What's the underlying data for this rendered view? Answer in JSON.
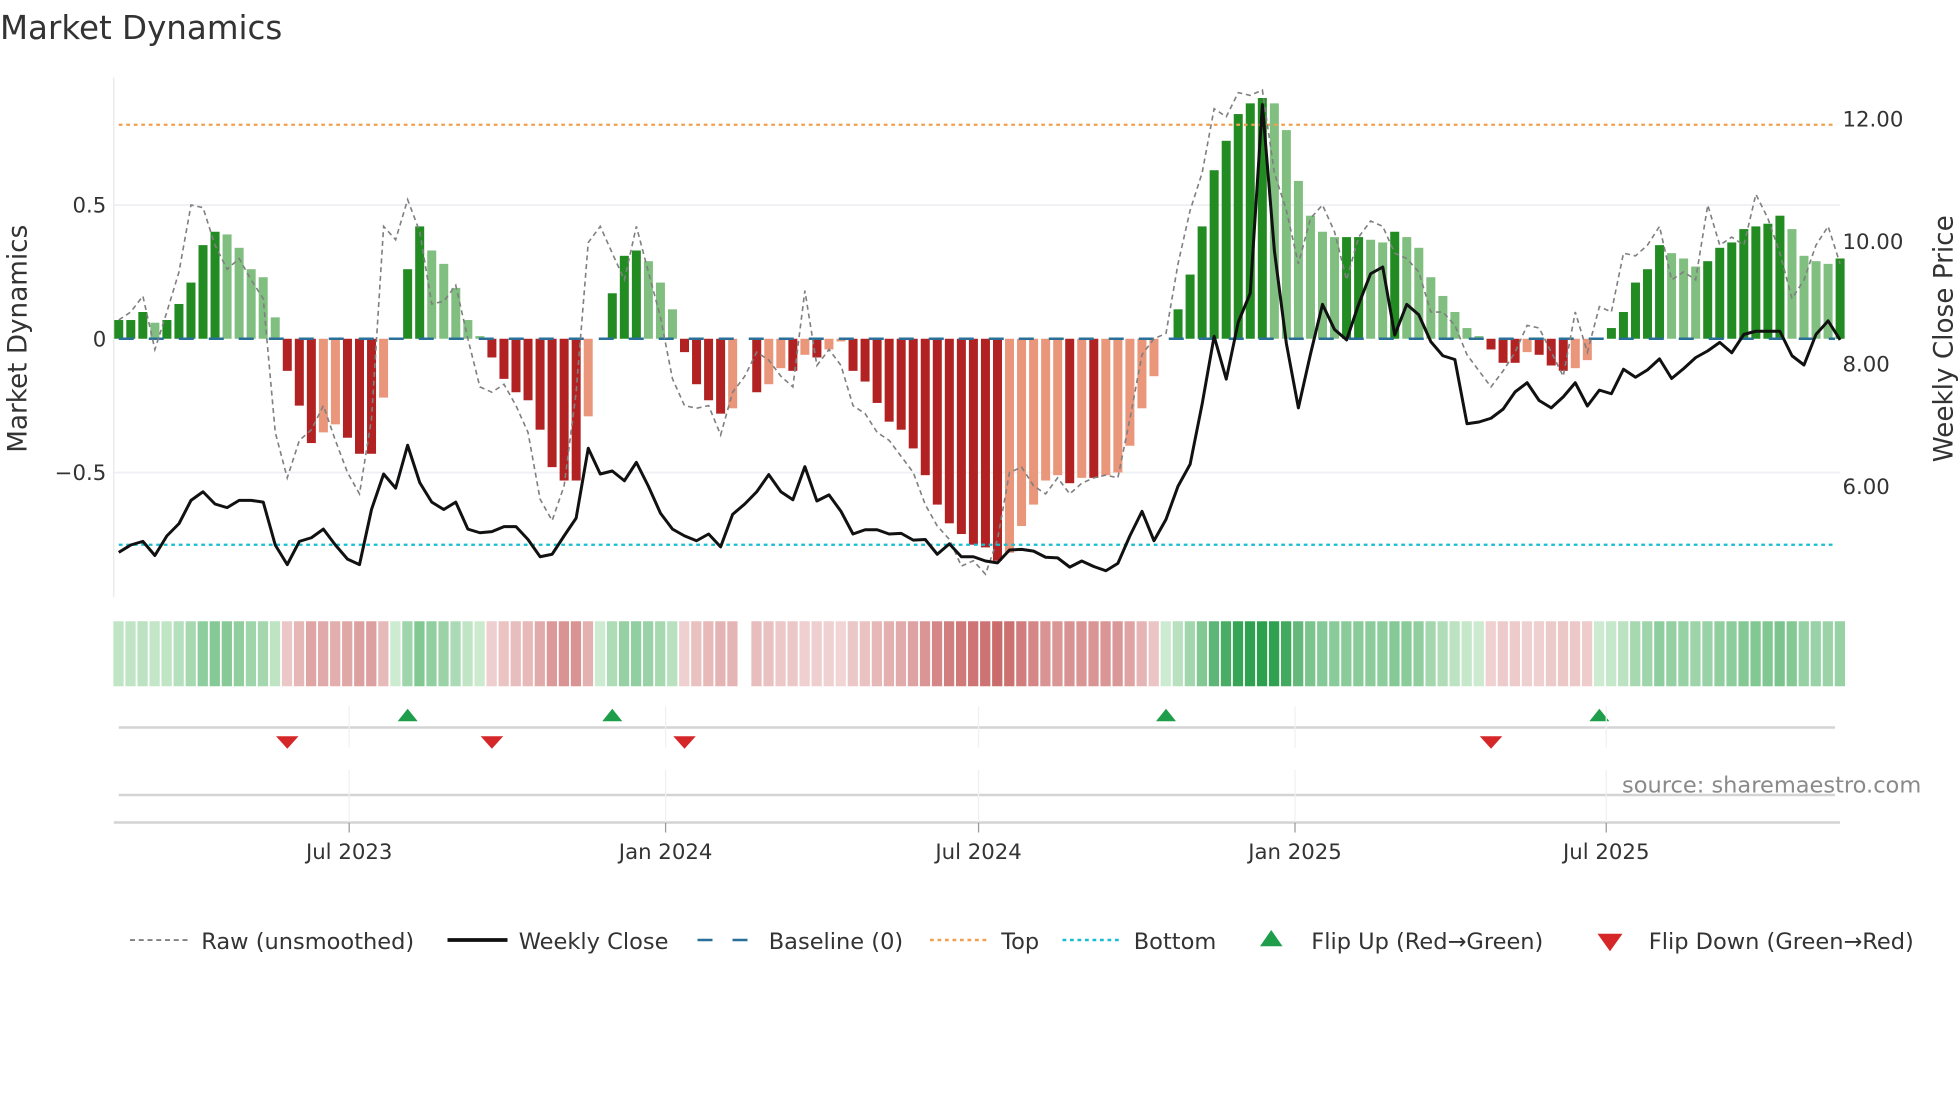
{
  "title": "Market Dynamics",
  "source": "source: sharemaestro.com",
  "chart_data": {
    "type": "bar",
    "title": "Market Dynamics",
    "ylabel": "Market Dynamics",
    "y2label": "Weekly Close Price",
    "ylim": [
      -1.0,
      0.97
    ],
    "y2lim": [
      3.85,
      13.3
    ],
    "start_date": "2023-02-17",
    "step_days": 7,
    "yticks": [
      {
        "v": 0.5,
        "label": "0.5"
      },
      {
        "v": 0,
        "label": "0"
      },
      {
        "v": -0.5,
        "label": "−0.5"
      }
    ],
    "y2ticks": [
      {
        "v": 12,
        "label": "12.00"
      },
      {
        "v": 10,
        "label": "10.00"
      },
      {
        "v": 8,
        "label": "8.00"
      },
      {
        "v": 6,
        "label": "6.00"
      }
    ],
    "xticks": [
      {
        "date": "2023-07-01",
        "label": "Jul 2023"
      },
      {
        "date": "2024-01-01",
        "label": "Jan 2024"
      },
      {
        "date": "2024-07-01",
        "label": "Jul 2024"
      },
      {
        "date": "2025-01-01",
        "label": "Jan 2025"
      },
      {
        "date": "2025-07-01",
        "label": "Jul 2025"
      }
    ],
    "top_level": 0.8,
    "bottom_level": -0.77,
    "baseline": 0,
    "dynamics": [
      0.07,
      0.07,
      0.1,
      0.06,
      0.07,
      0.13,
      0.21,
      0.35,
      0.4,
      0.39,
      0.34,
      0.26,
      0.23,
      0.08,
      -0.12,
      -0.25,
      -0.39,
      -0.35,
      -0.32,
      -0.37,
      -0.43,
      -0.43,
      -0.22,
      0.0,
      0.26,
      0.42,
      0.33,
      0.28,
      0.19,
      0.07,
      0.01,
      -0.07,
      -0.15,
      -0.2,
      -0.23,
      -0.34,
      -0.48,
      -0.53,
      -0.53,
      -0.29,
      0.0,
      0.17,
      0.31,
      0.33,
      0.29,
      0.21,
      0.11,
      -0.05,
      -0.17,
      -0.23,
      -0.28,
      -0.26,
      0.0,
      -0.2,
      -0.17,
      -0.11,
      -0.12,
      -0.06,
      -0.07,
      -0.04,
      -0.01,
      -0.12,
      -0.16,
      -0.24,
      -0.31,
      -0.34,
      -0.41,
      -0.51,
      -0.62,
      -0.69,
      -0.73,
      -0.77,
      -0.78,
      -0.83,
      -0.8,
      -0.7,
      -0.62,
      -0.53,
      -0.51,
      -0.54,
      -0.52,
      -0.52,
      -0.51,
      -0.5,
      -0.4,
      -0.26,
      -0.14,
      0.0,
      0.11,
      0.24,
      0.42,
      0.63,
      0.74,
      0.84,
      0.88,
      0.9,
      0.88,
      0.78,
      0.59,
      0.46,
      0.4,
      0.38,
      0.38,
      0.38,
      0.37,
      0.36,
      0.4,
      0.38,
      0.34,
      0.23,
      0.16,
      0.1,
      0.04,
      0.01,
      -0.04,
      -0.09,
      -0.09,
      -0.05,
      -0.06,
      -0.1,
      -0.12,
      -0.11,
      -0.08,
      0.0,
      0.04,
      0.1,
      0.21,
      0.26,
      0.35,
      0.32,
      0.3,
      0.27,
      0.29,
      0.34,
      0.36,
      0.41,
      0.42,
      0.43,
      0.46,
      0.41,
      0.31,
      0.29,
      0.28,
      0.3
    ],
    "raw": [
      0.07,
      0.1,
      0.16,
      -0.04,
      0.1,
      0.25,
      0.5,
      0.49,
      0.35,
      0.26,
      0.3,
      0.22,
      0.15,
      -0.35,
      -0.52,
      -0.38,
      -0.34,
      -0.25,
      -0.38,
      -0.5,
      -0.58,
      -0.3,
      0.42,
      0.37,
      0.52,
      0.4,
      0.13,
      0.14,
      0.2,
      0.0,
      -0.18,
      -0.2,
      -0.17,
      -0.25,
      -0.35,
      -0.6,
      -0.68,
      -0.55,
      -0.2,
      0.36,
      0.42,
      0.32,
      0.22,
      0.42,
      0.25,
      0.08,
      -0.15,
      -0.25,
      -0.26,
      -0.25,
      -0.36,
      -0.2,
      -0.14,
      -0.05,
      -0.08,
      -0.14,
      -0.18,
      0.18,
      -0.1,
      -0.04,
      -0.1,
      -0.25,
      -0.28,
      -0.35,
      -0.38,
      -0.44,
      -0.5,
      -0.62,
      -0.7,
      -0.75,
      -0.85,
      -0.83,
      -0.88,
      -0.75,
      -0.5,
      -0.48,
      -0.55,
      -0.58,
      -0.52,
      -0.58,
      -0.54,
      -0.52,
      -0.51,
      -0.52,
      -0.3,
      -0.06,
      0.0,
      0.02,
      0.28,
      0.48,
      0.62,
      0.86,
      0.83,
      0.92,
      0.91,
      0.93,
      0.62,
      0.48,
      0.28,
      0.45,
      0.5,
      0.4,
      0.22,
      0.38,
      0.44,
      0.42,
      0.32,
      0.3,
      0.25,
      0.1,
      0.1,
      0.05,
      -0.06,
      -0.12,
      -0.18,
      -0.12,
      -0.05,
      0.05,
      0.04,
      -0.05,
      -0.14,
      0.1,
      -0.05,
      0.12,
      0.1,
      0.32,
      0.31,
      0.35,
      0.42,
      0.22,
      0.25,
      0.22,
      0.5,
      0.35,
      0.38,
      0.35,
      0.54,
      0.45,
      0.32,
      0.15,
      0.22,
      0.35,
      0.42,
      0.28
    ],
    "close": [
      4.92,
      5.04,
      5.1,
      4.87,
      5.19,
      5.39,
      5.77,
      5.91,
      5.71,
      5.65,
      5.77,
      5.77,
      5.74,
      5.04,
      4.72,
      5.1,
      5.16,
      5.3,
      5.04,
      4.81,
      4.72,
      5.62,
      6.2,
      5.97,
      6.67,
      6.06,
      5.74,
      5.62,
      5.74,
      5.3,
      5.24,
      5.26,
      5.34,
      5.34,
      5.13,
      4.85,
      4.89,
      5.19,
      5.48,
      6.62,
      6.2,
      6.25,
      6.09,
      6.39,
      6.0,
      5.56,
      5.3,
      5.19,
      5.11,
      5.22,
      5.01,
      5.54,
      5.71,
      5.91,
      6.19,
      5.91,
      5.78,
      6.32,
      5.76,
      5.86,
      5.59,
      5.22,
      5.29,
      5.29,
      5.22,
      5.23,
      5.12,
      5.13,
      4.89,
      5.06,
      4.85,
      4.85,
      4.78,
      4.75,
      4.96,
      4.97,
      4.94,
      4.84,
      4.83,
      4.68,
      4.78,
      4.69,
      4.62,
      4.74,
      5.19,
      5.59,
      5.11,
      5.46,
      6.0,
      6.36,
      7.34,
      8.45,
      7.75,
      8.68,
      9.15,
      12.23,
      9.85,
      8.33,
      7.28,
      8.16,
      8.97,
      8.56,
      8.39,
      8.97,
      9.47,
      9.58,
      8.47,
      8.97,
      8.8,
      8.36,
      8.13,
      8.07,
      7.02,
      7.05,
      7.11,
      7.26,
      7.54,
      7.69,
      7.4,
      7.28,
      7.46,
      7.69,
      7.31,
      7.57,
      7.51,
      7.91,
      7.78,
      7.9,
      8.08,
      7.76,
      7.92,
      8.1,
      8.21,
      8.35,
      8.18,
      8.48,
      8.53,
      8.53,
      8.53,
      8.13,
      7.98,
      8.48,
      8.7,
      8.39
    ],
    "flip_up": [
      "2023-08-04",
      "2023-12-01",
      "2024-10-18",
      "2025-06-27"
    ],
    "flip_down": [
      "2023-05-26",
      "2023-09-22",
      "2024-01-12",
      "2025-04-25"
    ],
    "colors": {
      "pos_strong": "#228b22",
      "pos_weak": "#80bf80",
      "neg_strong": "#b22222",
      "neg_weak": "#e9967a",
      "raw": "#808080",
      "close": "#111111",
      "baseline": "#2a6f97",
      "top": "#f0a050",
      "bottom": "#17becf",
      "flip_up": "#1e9e4a",
      "flip_down": "#d62728"
    },
    "legend": [
      {
        "key": "raw",
        "label": "Raw (unsmoothed)"
      },
      {
        "key": "close",
        "label": "Weekly Close"
      },
      {
        "key": "baseline",
        "label": "Baseline (0)"
      },
      {
        "key": "top",
        "label": "Top"
      },
      {
        "key": "bottom",
        "label": "Bottom"
      },
      {
        "key": "flip_up",
        "label": "Flip Up (Red→Green)"
      },
      {
        "key": "flip_down",
        "label": "Flip Down (Green→Red)"
      }
    ]
  }
}
